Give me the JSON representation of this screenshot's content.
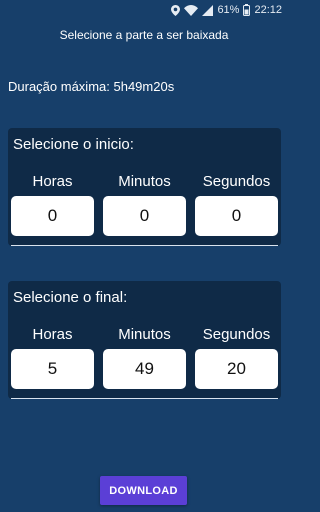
{
  "status_bar": {
    "battery": "61%",
    "time": "22:12",
    "icons": [
      "location-icon",
      "wifi-icon",
      "signal-icon",
      "battery-icon"
    ]
  },
  "header": {
    "title": "Selecione a parte a ser baixada"
  },
  "max_duration": "Duração máxima: 5h49m20s",
  "start": {
    "title": "Selecione o inicio:",
    "labels": {
      "hours": "Horas",
      "minutes": "Minutos",
      "seconds": "Segundos"
    },
    "values": {
      "hours": "0",
      "minutes": "0",
      "seconds": "0"
    }
  },
  "end": {
    "title": "Selecione o final:",
    "labels": {
      "hours": "Horas",
      "minutes": "Minutos",
      "seconds": "Segundos"
    },
    "values": {
      "hours": "5",
      "minutes": "49",
      "seconds": "20"
    }
  },
  "download_label": "DOWNLOAD",
  "colors": {
    "background": "#173f6a",
    "panel": "#0f2a47",
    "button": "#5b3fd6"
  }
}
